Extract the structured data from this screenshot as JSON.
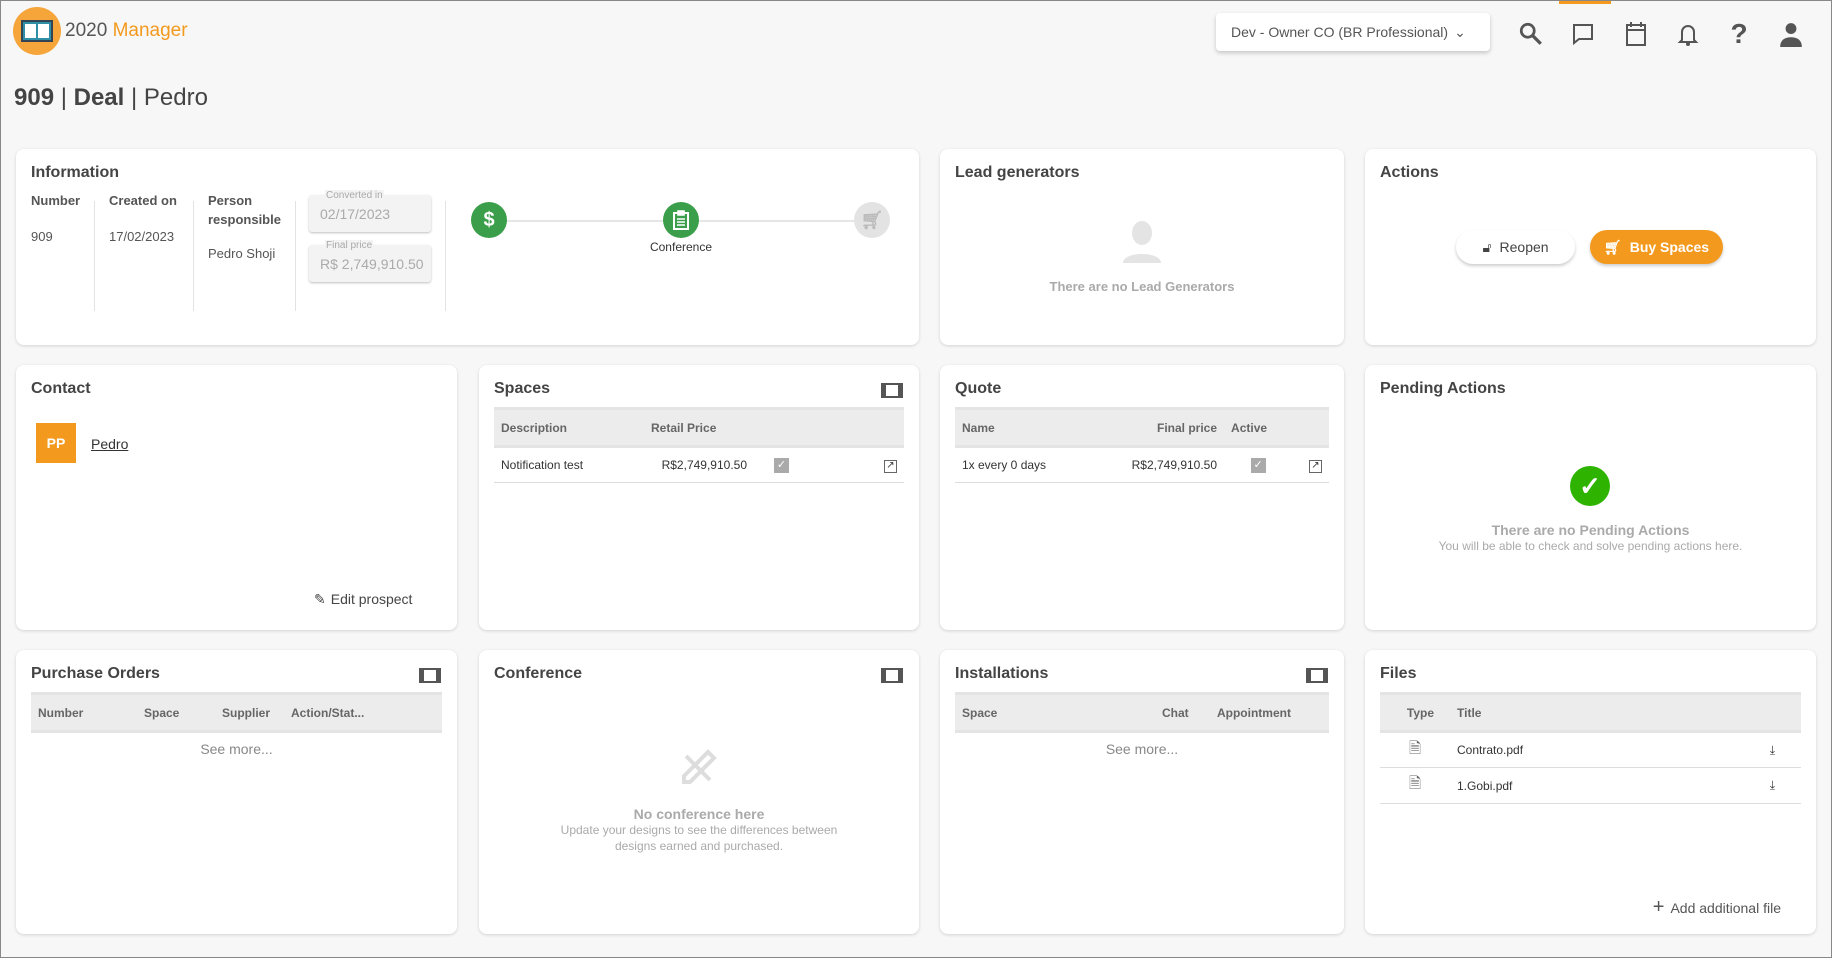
{
  "app": {
    "name_part1": "2020",
    "name_part2": "Manager",
    "org_selector": "Dev - Owner CO (BR Professional)"
  },
  "header_icons": [
    "search-icon",
    "chat-icon",
    "calendar-icon",
    "bell-icon",
    "help-icon",
    "user-icon"
  ],
  "page": {
    "number": "909",
    "type": "Deal",
    "name": "Pedro",
    "sep": "|"
  },
  "information": {
    "title": "Information",
    "number_label": "Number",
    "number": "909",
    "created_label": "Created on",
    "created": "17/02/2023",
    "person_label": "Person responsible",
    "person": "Pedro Shoji",
    "converted_label": "Converted in",
    "converted": "02/17/2023",
    "final_label": "Final price",
    "final": "R$ 2,749,910.50",
    "current_step": "Conference"
  },
  "lead": {
    "title": "Lead generators",
    "empty": "There are no Lead Generators"
  },
  "actions": {
    "title": "Actions",
    "reopen": "Reopen",
    "buy": "Buy Spaces"
  },
  "contact": {
    "title": "Contact",
    "initials": "PP",
    "name": "Pedro",
    "edit": "Edit prospect"
  },
  "spaces": {
    "title": "Spaces",
    "headers": [
      "Description",
      "Retail Price"
    ],
    "rows": [
      {
        "description": "Notification test",
        "price": "R$2,749,910.50",
        "check": "✓"
      }
    ]
  },
  "quote": {
    "title": "Quote",
    "headers": [
      "Name",
      "Final price",
      "Active"
    ],
    "rows": [
      {
        "name": "1x every 0 days",
        "price": "R$2,749,910.50",
        "check": "✓"
      }
    ]
  },
  "pending": {
    "title": "Pending Actions",
    "empty": "There are no Pending Actions",
    "sub": "You will be able to check and solve pending actions here."
  },
  "purchase": {
    "title": "Purchase Orders",
    "headers": [
      "Number",
      "Space",
      "Supplier",
      "Action/Stat..."
    ],
    "see_more": "See more..."
  },
  "conference": {
    "title": "Conference",
    "empty": "No conference here",
    "sub": "Update your designs to see the differences between designs earned and purchased."
  },
  "installations": {
    "title": "Installations",
    "headers": [
      "Space",
      "Chat",
      "Appointment"
    ],
    "see_more": "See more..."
  },
  "files": {
    "title": "Files",
    "headers": [
      "Type",
      "Title"
    ],
    "rows": [
      {
        "title": "Contrato.pdf"
      },
      {
        "title": "1.Gobi.pdf"
      }
    ],
    "add": "Add additional file"
  },
  "colors": {
    "accent": "#f39a1e",
    "green": "#3a9e4a",
    "check_green": "#2db300"
  }
}
